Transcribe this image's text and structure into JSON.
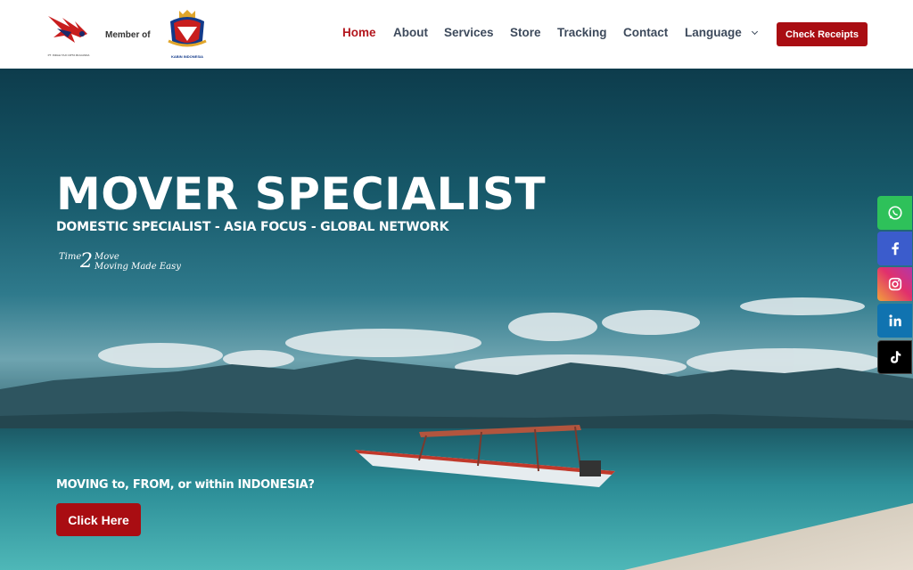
{
  "header": {
    "logo_small_text": "PT. INDAH TAJI CIPTA MULIANDA",
    "member_of": "Member of",
    "partner_logo_text": "KABIN INDONESIA"
  },
  "nav": {
    "home": "Home",
    "about": "About",
    "services": "Services",
    "store": "Store",
    "tracking": "Tracking",
    "contact": "Contact",
    "language": "Language"
  },
  "check_receipts": "Check Receipts",
  "hero": {
    "title": "MOVER SPECIALIST",
    "subtitle": "DOMESTIC SPECIALIST - ASIA FOCUS - GLOBAL NETWORK",
    "tagline_time": "Time",
    "tagline_two": "2",
    "tagline_move": "Move",
    "tagline_easy": "Moving Made Easy",
    "question": "MOVING to, FROM, or within INDONESIA?",
    "cta": "Click Here"
  },
  "social": [
    "whatsapp-icon",
    "facebook-icon",
    "instagram-icon",
    "linkedin-icon",
    "tiktok-icon"
  ],
  "colors": {
    "accent": "#a90d12",
    "nav_text": "#3d4a5c",
    "nav_active": "#b3161d"
  }
}
